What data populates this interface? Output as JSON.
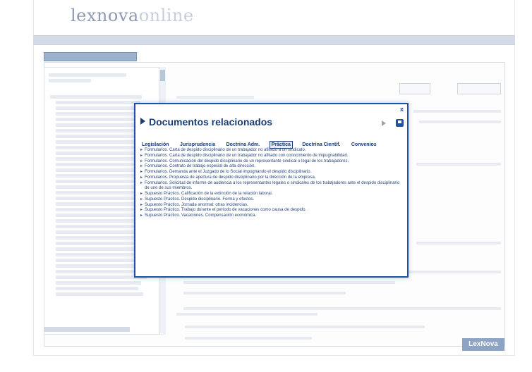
{
  "header": {
    "logo_main": "lexnova",
    "logo_suffix": "online"
  },
  "modal": {
    "title": "Documentos relacionados",
    "close": "x",
    "tabs": [
      {
        "label": "Legislación",
        "active": false
      },
      {
        "label": "Jurisprudencia",
        "active": false
      },
      {
        "label": "Doctrina Adm.",
        "active": false
      },
      {
        "label": "Práctica",
        "active": true
      },
      {
        "label": "Doctrina Científ.",
        "active": false
      },
      {
        "label": "Convenios",
        "active": false
      }
    ],
    "results": [
      "Formularios. Carta de despido disciplinario de un trabajador no afiliado a un sindicato.",
      "Formularios. Carta de despido disciplinario de un trabajador no afiliado con conocimiento de impugnabilidad.",
      "Formularios. Comunicación del despido disciplinario de un representante sindical o legal de los trabajadores.",
      "Formularios. Contrato de trabajo especial de alta dirección.",
      "Formularios. Demanda ante el Juzgado de lo Social impugnando el despido disciplinario.",
      "Formularios. Propuesta de apertura de despido disciplinario por la dirección de la empresa.",
      "Formularios. Solicitud de informe de audiencia a los representantes legales o sindicales de los trabajadores ante el despido disciplinario de uno de sus miembros.",
      "Supuesto Práctico. Calificación de la extinción de la relación laboral.",
      "Supuesto Práctico. Despido disciplinario. Forma y efectos.",
      "Supuesto Práctico. Jornada anormal: otras incidencias.",
      "Supuesto Práctico. Trabajo durante el período de vacaciones como causa de despido.",
      "Supuesto Práctico. Vacaciones. Compensación económica."
    ]
  },
  "footer": {
    "badge": "LexNova"
  }
}
